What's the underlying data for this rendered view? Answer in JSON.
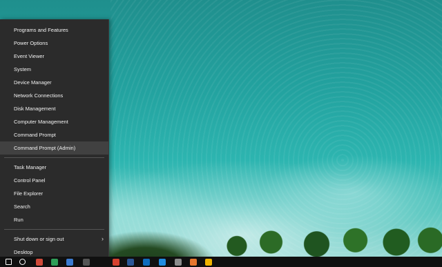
{
  "menu": {
    "group1": [
      {
        "label": "Programs and Features"
      },
      {
        "label": "Power Options"
      },
      {
        "label": "Event Viewer"
      },
      {
        "label": "System"
      },
      {
        "label": "Device Manager"
      },
      {
        "label": "Network Connections"
      },
      {
        "label": "Disk Management"
      },
      {
        "label": "Computer Management"
      },
      {
        "label": "Command Prompt"
      },
      {
        "label": "Command Prompt (Admin)"
      }
    ],
    "group2": [
      {
        "label": "Task Manager"
      },
      {
        "label": "Control Panel"
      },
      {
        "label": "File Explorer"
      },
      {
        "label": "Search"
      },
      {
        "label": "Run"
      }
    ],
    "group3": [
      {
        "label": "Shut down or sign out",
        "arrow": "›"
      },
      {
        "label": "Desktop"
      }
    ]
  },
  "taskbar": {
    "icons": [
      {
        "name": "start-icon",
        "color": "#ffffff"
      },
      {
        "name": "cortana-icon",
        "color": "#ffffff"
      },
      {
        "name": "app-icon-red",
        "color": "#d04a3a"
      },
      {
        "name": "app-icon-green",
        "color": "#2f9e58"
      },
      {
        "name": "app-icon-blue",
        "color": "#3b7bd1"
      },
      {
        "name": "app-icon-dark",
        "color": "#555555"
      },
      {
        "name": "chrome-icon",
        "color": "#d6412f"
      },
      {
        "name": "word-icon",
        "color": "#2b5797"
      },
      {
        "name": "outlook-icon",
        "color": "#0f6cbd"
      },
      {
        "name": "edge-icon",
        "color": "#1f8ce0"
      },
      {
        "name": "settings-icon",
        "color": "#8c8c8c"
      },
      {
        "name": "firefox-icon",
        "color": "#e8762d"
      },
      {
        "name": "media-icon",
        "color": "#f0b400"
      }
    ]
  }
}
